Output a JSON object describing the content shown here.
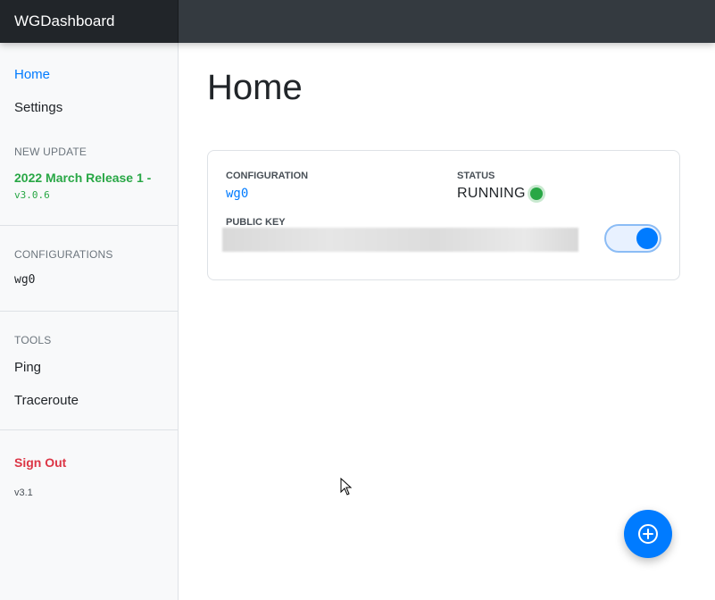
{
  "app": {
    "brand": "WGDashboard"
  },
  "sidebar": {
    "nav": [
      {
        "label": "Home",
        "active": true
      },
      {
        "label": "Settings",
        "active": false
      }
    ],
    "update": {
      "heading": "NEW UPDATE",
      "release_name": "2022 March Release 1 -",
      "release_version": "v3.0.6"
    },
    "configurations": {
      "heading": "CONFIGURATIONS",
      "items": [
        "wg0"
      ]
    },
    "tools": {
      "heading": "TOOLS",
      "items": [
        "Ping",
        "Traceroute"
      ]
    },
    "sign_out": "Sign Out",
    "version": "v3.1"
  },
  "main": {
    "title": "Home",
    "card": {
      "configuration_label": "CONFIGURATION",
      "configuration_name": "wg0",
      "status_label": "STATUS",
      "status_value": "RUNNING",
      "public_key_label": "PUBLIC KEY",
      "toggle_on": true
    }
  },
  "colors": {
    "accent": "#007bff",
    "success": "#28a745",
    "danger": "#dc3545",
    "topbar": "#343a40"
  },
  "icons": {
    "fab": "plus-circle-icon",
    "status": "status-dot-icon",
    "cursor": "mouse-cursor-icon"
  }
}
